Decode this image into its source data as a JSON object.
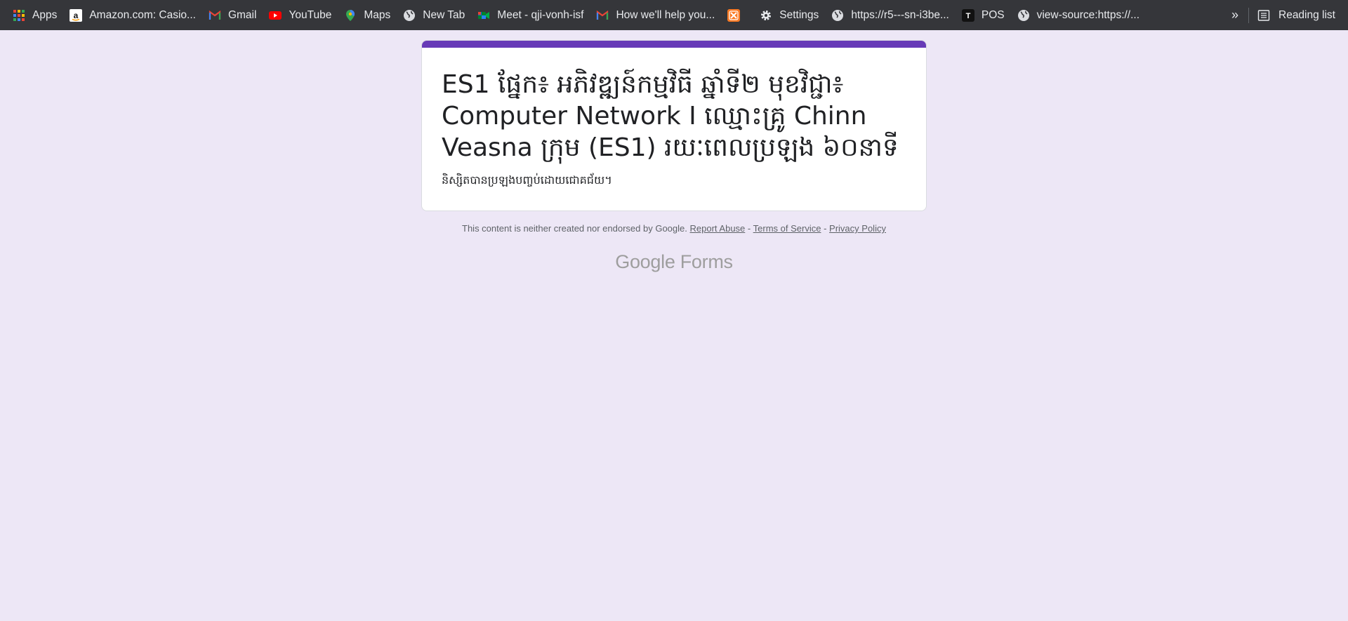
{
  "bookmarks": [
    {
      "label": "Apps",
      "icon": "apps-grid-icon"
    },
    {
      "label": "Amazon.com: Casio...",
      "icon": "amazon-icon"
    },
    {
      "label": "Gmail",
      "icon": "gmail-icon"
    },
    {
      "label": "YouTube",
      "icon": "youtube-icon"
    },
    {
      "label": "Maps",
      "icon": "maps-pin-icon"
    },
    {
      "label": "New Tab",
      "icon": "globe-icon"
    },
    {
      "label": "Meet - qji-vonh-isf",
      "icon": "meet-icon"
    },
    {
      "label": "How we'll help you...",
      "icon": "gmail-icon"
    },
    {
      "label": "",
      "icon": "xampp-icon"
    },
    {
      "label": "Settings",
      "icon": "gear-icon"
    },
    {
      "label": "https://r5---sn-i3be...",
      "icon": "globe-icon"
    },
    {
      "label": "POS",
      "icon": "pos-t-icon"
    },
    {
      "label": "view-source:https://...",
      "icon": "globe-icon"
    }
  ],
  "overflow_label": "»",
  "reading_list_label": "Reading list",
  "form": {
    "title": "ES1 ផ្នែក៖ អភិវឌ្ឍន៍កម្មវិធី ឆ្នាំទី២ មុខវិជ្ជា៖ Computer Network I ឈ្មោះគ្រូ Chinn Veasna ក្រុម (ES1) រយៈពេលប្រឡង ៦០នាទី",
    "description": "និស្សិតបានប្រឡងបញ្ចប់ដោយជោគជ័យ។",
    "accent_color": "#673ab7"
  },
  "footer": {
    "disclaimer": "This content is neither created nor endorsed by Google.",
    "sep": "-",
    "report_abuse": "Report Abuse",
    "terms": "Terms of Service",
    "privacy": "Privacy Policy"
  },
  "brand": {
    "google": "Google",
    "forms": "Forms"
  },
  "colors": {
    "page_background": "#ede7f6",
    "bookmarks_bar": "#35363a"
  }
}
